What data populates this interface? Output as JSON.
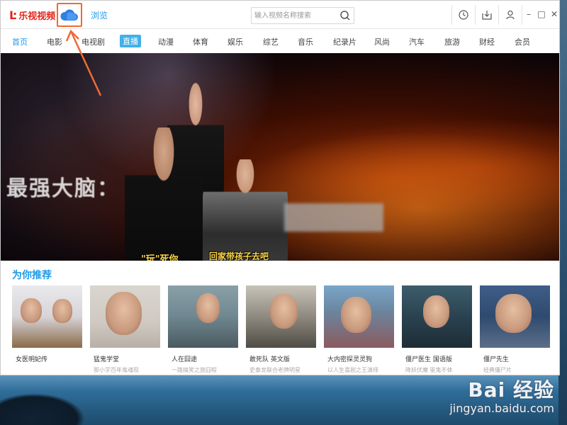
{
  "app": {
    "logo_text": "乐视视频",
    "browse_tab": "浏览",
    "accent_color": "#1e9be9",
    "brand_color": "#e1251b",
    "highlight_color": "#f06a35"
  },
  "search": {
    "placeholder": "输入视频名称搜索"
  },
  "toolbar": {
    "icons": [
      "history-icon",
      "download-icon",
      "user-icon"
    ]
  },
  "window_controls": {
    "minimize": "–",
    "maximize": "□",
    "close": "✕"
  },
  "nav": {
    "items": [
      "首页",
      "电影",
      "电视剧",
      "直播",
      "动漫",
      "体育",
      "娱乐",
      "综艺",
      "音乐",
      "纪录片",
      "风尚",
      "汽车",
      "旅游",
      "财经",
      "会员"
    ],
    "active": "首页",
    "highlighted": "直播"
  },
  "banner": {
    "title": "最强大脑：",
    "caption_left": "\"玩\"死你",
    "caption_right": "回家带孩子去吧"
  },
  "recommendations": {
    "heading": "为你推荐",
    "items": [
      {
        "title": "女医明妃传",
        "subtitle": ""
      },
      {
        "title": "猛鬼学堂",
        "subtitle": "那小学百年鬼魂现"
      },
      {
        "title": "人在囧途",
        "subtitle": "一路搞笑之旅囧程"
      },
      {
        "title": "敢死队 英文版",
        "subtitle": "史泰龙联合老牌明星"
      },
      {
        "title": "大内密探灵灵狗",
        "subtitle": "以人生喜剧之王演绎"
      },
      {
        "title": "僵尸医生 国语版",
        "subtitle": "降妖伏魔 驱鬼不休"
      },
      {
        "title": "僵尸先生",
        "subtitle": "经典僵尸片"
      }
    ]
  },
  "watermark": {
    "logo": "Bai 经验",
    "url": "jingyan.baidu.com"
  }
}
